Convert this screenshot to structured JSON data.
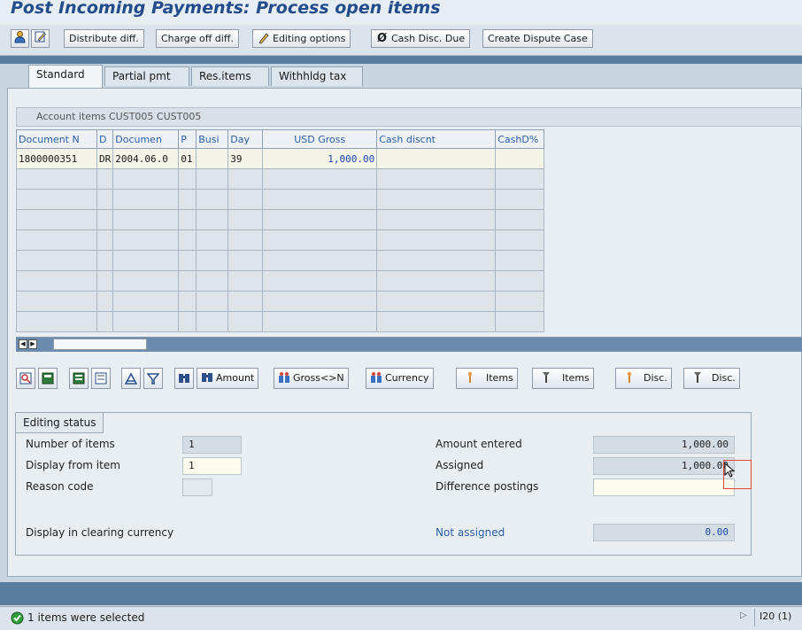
{
  "window": {
    "title": "Post Incoming Payments: Process open items"
  },
  "toolbar": {
    "icon1": "person-icon",
    "icon2": "edit-pencil-icon",
    "distribute_diff": "Distribute diff.",
    "charge_off_diff": "Charge off diff.",
    "editing_options": "Editing options",
    "cash_disc_due": "Cash Disc. Due",
    "create_dispute_case": "Create Dispute Case"
  },
  "tabs": [
    {
      "label": "Standard",
      "active": true
    },
    {
      "label": "Partial pmt",
      "active": false
    },
    {
      "label": "Res.items",
      "active": false
    },
    {
      "label": "Withhldg tax",
      "active": false
    }
  ],
  "table": {
    "caption": "Account items CUST005 CUST005",
    "columns": [
      "Document N",
      "D",
      "Documen",
      "P",
      "Busi",
      "Day",
      "USD Gross",
      "Cash discnt",
      "CashD%"
    ],
    "rows": [
      [
        "1800000351",
        "DR",
        "2004.06.0",
        "01",
        "",
        "39",
        "1,000.00",
        "",
        ""
      ]
    ]
  },
  "grid_buttons": {
    "amount": "Amount",
    "gross_net": "Gross<>N",
    "currency": "Currency",
    "items_select": "Items",
    "items_deselect": "Items",
    "disc_select": "Disc.",
    "disc_deselect": "Disc."
  },
  "editing_status": {
    "title": "Editing status",
    "number_of_items_label": "Number of items",
    "number_of_items": "1",
    "display_from_item_label": "Display from item",
    "display_from_item": "1",
    "reason_code_label": "Reason code",
    "reason_code": "",
    "display_clearing_currency_label": "Display in clearing currency",
    "amount_entered_label": "Amount entered",
    "amount_entered": "1,000.00",
    "assigned_label": "Assigned",
    "assigned": "1,000.00",
    "difference_postings_label": "Difference postings",
    "difference_postings": "",
    "not_assigned_label": "Not assigned",
    "not_assigned": "0.00"
  },
  "status_bar": {
    "message": "1 items were selected",
    "system": "I20 (1)"
  },
  "colors": {
    "title": "#244c8a",
    "link": "#2a5fa8",
    "band": "#5a7d9e",
    "success": "#2e9e3a"
  }
}
